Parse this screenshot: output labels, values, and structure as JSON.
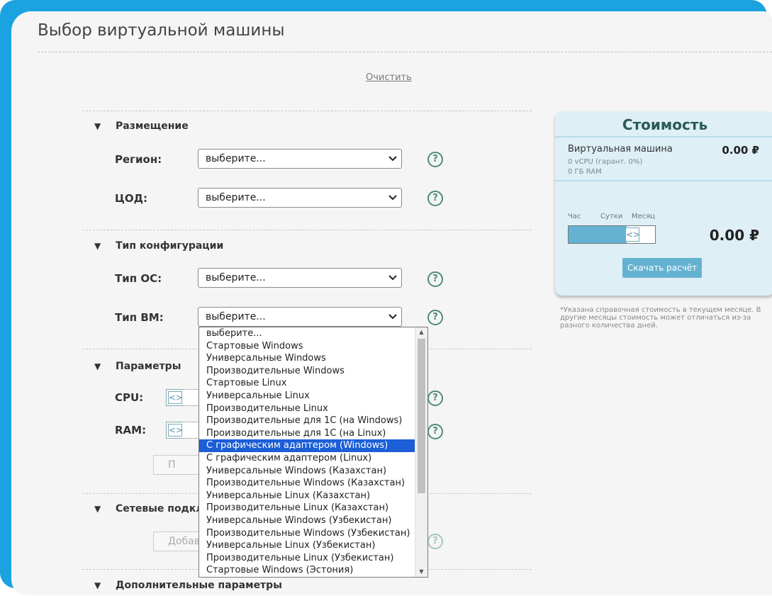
{
  "page": {
    "title": "Выбор виртуальной машины",
    "clear_label": "Очистить"
  },
  "sections": {
    "placement": {
      "title": "Размещение",
      "region_label": "Регион:",
      "dc_label": "ЦОД:"
    },
    "config": {
      "title": "Тип конфигурации",
      "os_label": "Тип ОС:",
      "vm_label": "Тип ВМ:"
    },
    "params": {
      "title": "Параметры",
      "cpu_label": "CPU:",
      "ram_label": "RAM:",
      "btn_partial": "П"
    },
    "network": {
      "title": "Сетевые подкл",
      "add_partial": "Добав"
    },
    "extra": {
      "title": "Дополнительные параметры"
    }
  },
  "select_placeholder": "выберите...",
  "help_glyph": "?",
  "collapse_glyph": "▼",
  "stepper_glyph": "<>",
  "dropdown": {
    "selected_index": 9,
    "options": [
      "выберите...",
      "Стартовые Windows",
      "Универсальные Windows",
      "Производительные Windows",
      "Стартовые Linux",
      "Универсальные Linux",
      "Производительные Linux",
      "Производительные для 1С (на Windows)",
      "Производительные для 1С (на Linux)",
      "С графическим адаптером (Windows)",
      "С графическим адаптером (Linux)",
      "Универсальные Windows (Казахстан)",
      "Производительные Windows (Казахстан)",
      "Универсальные Linux (Казахстан)",
      "Производительные Linux (Казахстан)",
      "Универсальные Windows (Узбекистан)",
      "Производительные Windows (Узбекистан)",
      "Универсальные Linux (Узбекистан)",
      "Производительные Linux (Узбекистан)",
      "Стартовые Windows (Эстония)"
    ]
  },
  "cost": {
    "title": "Стоимость",
    "vm_label": "Виртуальная машина",
    "vm_price": "0.00 ₽",
    "vcpu_line": "0 vCPU (гарант. 0%)",
    "ram_line": "0 ГБ RAM",
    "periods": [
      "Час",
      "Сутки",
      "Месяц"
    ],
    "slider_value": 0.8,
    "total_price": "0.00 ₽",
    "download_label": "Скачать расчёт",
    "note": "*Указана справочная стоимость в текущем месяце. В другие месяцы стоимость может отличаться из-за разного количества дней."
  },
  "colors": {
    "frame": "#1aa3e0",
    "accent": "#64b2d1",
    "selected": "#1c5ed6",
    "help": "#4f8a7c"
  }
}
